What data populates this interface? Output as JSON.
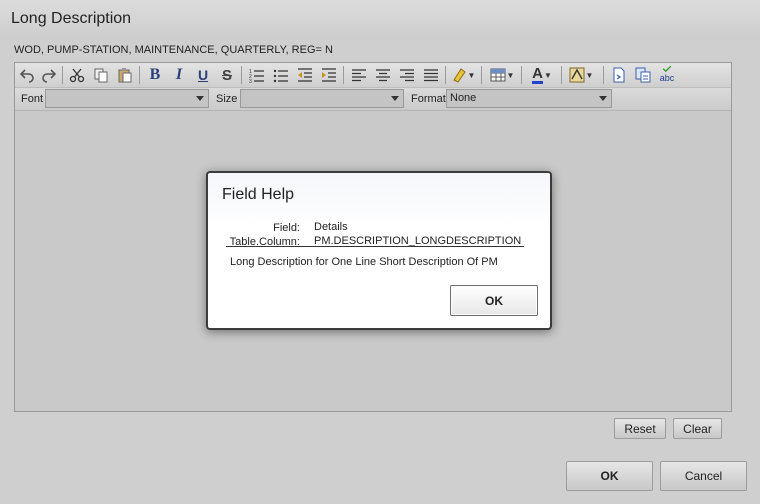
{
  "window": {
    "title": "Long Description"
  },
  "record_summary": "WOD, PUMP-STATION, MAINTENANCE, QUARTERLY, REG= N",
  "toolbar": {
    "icons": [
      "undo-icon",
      "redo-icon",
      "cut-icon",
      "copy-icon",
      "paste-icon",
      "bold-icon",
      "italic-icon",
      "underline-icon",
      "strikethrough-icon",
      "ordered-list-icon",
      "unordered-list-icon",
      "outdent-icon",
      "indent-icon",
      "align-left-icon",
      "align-center-icon",
      "align-right-icon",
      "justify-icon",
      "highlight-icon",
      "insert-table-icon",
      "font-color-icon",
      "background-color-icon",
      "insert-file-icon",
      "copy-format-icon",
      "spellcheck-icon"
    ],
    "bold_glyph": "B",
    "italic_glyph": "I",
    "underline_glyph": "U",
    "strike_glyph": "S",
    "font_color_glyph": "A",
    "spell_glyph": "abc"
  },
  "format_bar": {
    "font_label": "Font",
    "font_value": "",
    "size_label": "Size",
    "size_value": "",
    "format_label": "Format",
    "format_value": "None"
  },
  "editor_buttons": {
    "reset": "Reset",
    "clear": "Clear"
  },
  "footer_buttons": {
    "ok": "OK",
    "cancel": "Cancel"
  },
  "field_help": {
    "title": "Field Help",
    "field_label": "Field:",
    "field_value": "Details",
    "column_label": "Table.Column:",
    "column_value": "PM.DESCRIPTION_LONGDESCRIPTION",
    "help_text": "Long Description for One Line Short Description Of PM",
    "ok_label": "OK"
  },
  "colors": {
    "modal_border": "#3b3b3b",
    "page_background": "#cfcfcf"
  }
}
